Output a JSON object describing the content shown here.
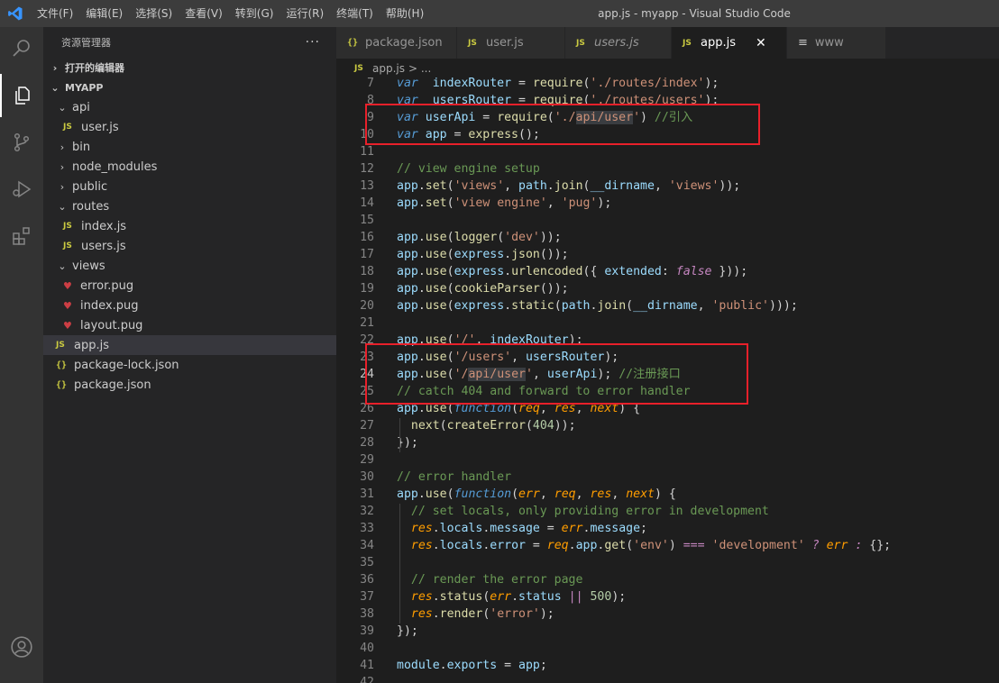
{
  "menu": [
    "文件(F)",
    "编辑(E)",
    "选择(S)",
    "查看(V)",
    "转到(G)",
    "运行(R)",
    "终端(T)",
    "帮助(H)"
  ],
  "window_title": "app.js - myapp - Visual Studio Code",
  "sidebar": {
    "title": "资源管理器",
    "more": "···",
    "open_editors": "打开的编辑器",
    "project": "MYAPP",
    "tree": [
      {
        "label": "api",
        "type": "folder-open",
        "indent": 1
      },
      {
        "label": "user.js",
        "type": "js",
        "indent": 2
      },
      {
        "label": "bin",
        "type": "folder",
        "indent": 1
      },
      {
        "label": "node_modules",
        "type": "folder",
        "indent": 1
      },
      {
        "label": "public",
        "type": "folder",
        "indent": 1
      },
      {
        "label": "routes",
        "type": "folder-open",
        "indent": 1
      },
      {
        "label": "index.js",
        "type": "js",
        "indent": 2
      },
      {
        "label": "users.js",
        "type": "js",
        "indent": 2
      },
      {
        "label": "views",
        "type": "folder-open",
        "indent": 1
      },
      {
        "label": "error.pug",
        "type": "pug",
        "indent": 2
      },
      {
        "label": "index.pug",
        "type": "pug",
        "indent": 2
      },
      {
        "label": "layout.pug",
        "type": "pug",
        "indent": 2
      },
      {
        "label": "app.js",
        "type": "js",
        "indent": 1,
        "selected": true
      },
      {
        "label": "package-lock.json",
        "type": "json",
        "indent": 1
      },
      {
        "label": "package.json",
        "type": "json",
        "indent": 1
      }
    ]
  },
  "tabs": [
    {
      "label": "package.json",
      "icon": "{}",
      "italic": false,
      "active": false
    },
    {
      "label": "user.js",
      "icon": "JS",
      "italic": false,
      "active": false
    },
    {
      "label": "users.js",
      "icon": "JS",
      "italic": true,
      "active": false
    },
    {
      "label": "app.js",
      "icon": "JS",
      "italic": false,
      "active": true,
      "close": "✕"
    },
    {
      "label": "www",
      "icon": "≡",
      "italic": false,
      "active": false
    }
  ],
  "breadcrumb": {
    "file": "app.js",
    "rest": "> ..."
  },
  "code": [
    {
      "n": 7,
      "tokens": [
        [
          "kw",
          "var"
        ],
        [
          "",
          "  "
        ],
        [
          "var",
          "indexRouter"
        ],
        [
          "op",
          " = "
        ],
        [
          "fn",
          "require"
        ],
        [
          "op",
          "("
        ],
        [
          "str",
          "'./routes/index'"
        ],
        [
          "op",
          ");"
        ]
      ]
    },
    {
      "n": 8,
      "tokens": [
        [
          "kw",
          "var"
        ],
        [
          "",
          "  "
        ],
        [
          "var",
          "usersRouter"
        ],
        [
          "op",
          " = "
        ],
        [
          "fn",
          "require"
        ],
        [
          "op",
          "("
        ],
        [
          "str",
          "'./routes/users'"
        ],
        [
          "op",
          ");"
        ]
      ]
    },
    {
      "n": 9,
      "tokens": [
        [
          "kw",
          "var"
        ],
        [
          "",
          ""
        ],
        [
          "var",
          " userApi"
        ],
        [
          "op",
          " = "
        ],
        [
          "fn",
          "require"
        ],
        [
          "op",
          "("
        ],
        [
          "str",
          "'./"
        ],
        [
          "str hl",
          "api/user"
        ],
        [
          "str",
          "'"
        ],
        [
          "op",
          ") "
        ],
        [
          "cm",
          "//引入"
        ]
      ]
    },
    {
      "n": 10,
      "tokens": [
        [
          "kw",
          "var"
        ],
        [
          "var",
          " app"
        ],
        [
          "op",
          " = "
        ],
        [
          "fn",
          "express"
        ],
        [
          "op",
          "();"
        ]
      ]
    },
    {
      "n": 11,
      "tokens": []
    },
    {
      "n": 12,
      "tokens": [
        [
          "cm",
          "// view engine setup"
        ]
      ]
    },
    {
      "n": 13,
      "tokens": [
        [
          "var",
          "app"
        ],
        [
          "op",
          "."
        ],
        [
          "fn",
          "set"
        ],
        [
          "op",
          "("
        ],
        [
          "str",
          "'views'"
        ],
        [
          "op",
          ", "
        ],
        [
          "var",
          "path"
        ],
        [
          "op",
          "."
        ],
        [
          "fn",
          "join"
        ],
        [
          "op",
          "("
        ],
        [
          "var",
          "__dirname"
        ],
        [
          "op",
          ", "
        ],
        [
          "str",
          "'views'"
        ],
        [
          "op",
          "));"
        ]
      ]
    },
    {
      "n": 14,
      "tokens": [
        [
          "var",
          "app"
        ],
        [
          "op",
          "."
        ],
        [
          "fn",
          "set"
        ],
        [
          "op",
          "("
        ],
        [
          "str",
          "'view engine'"
        ],
        [
          "op",
          ", "
        ],
        [
          "str",
          "'pug'"
        ],
        [
          "op",
          ");"
        ]
      ]
    },
    {
      "n": 15,
      "tokens": []
    },
    {
      "n": 16,
      "tokens": [
        [
          "var",
          "app"
        ],
        [
          "op",
          "."
        ],
        [
          "fn",
          "use"
        ],
        [
          "op",
          "("
        ],
        [
          "fn",
          "logger"
        ],
        [
          "op",
          "("
        ],
        [
          "str",
          "'dev'"
        ],
        [
          "op",
          "));"
        ]
      ]
    },
    {
      "n": 17,
      "tokens": [
        [
          "var",
          "app"
        ],
        [
          "op",
          "."
        ],
        [
          "fn",
          "use"
        ],
        [
          "op",
          "("
        ],
        [
          "var",
          "express"
        ],
        [
          "op",
          "."
        ],
        [
          "fn",
          "json"
        ],
        [
          "op",
          "());"
        ]
      ]
    },
    {
      "n": 18,
      "tokens": [
        [
          "var",
          "app"
        ],
        [
          "op",
          "."
        ],
        [
          "fn",
          "use"
        ],
        [
          "op",
          "("
        ],
        [
          "var",
          "express"
        ],
        [
          "op",
          "."
        ],
        [
          "fn",
          "urlencoded"
        ],
        [
          "op",
          "({ "
        ],
        [
          "var",
          "extended"
        ],
        [
          "op",
          ": "
        ],
        [
          "kw2",
          "false"
        ],
        [
          "op",
          " }));"
        ]
      ]
    },
    {
      "n": 19,
      "tokens": [
        [
          "var",
          "app"
        ],
        [
          "op",
          "."
        ],
        [
          "fn",
          "use"
        ],
        [
          "op",
          "("
        ],
        [
          "fn",
          "cookieParser"
        ],
        [
          "op",
          "());"
        ]
      ]
    },
    {
      "n": 20,
      "tokens": [
        [
          "var",
          "app"
        ],
        [
          "op",
          "."
        ],
        [
          "fn",
          "use"
        ],
        [
          "op",
          "("
        ],
        [
          "var",
          "express"
        ],
        [
          "op",
          "."
        ],
        [
          "fn",
          "static"
        ],
        [
          "op",
          "("
        ],
        [
          "var",
          "path"
        ],
        [
          "op",
          "."
        ],
        [
          "fn",
          "join"
        ],
        [
          "op",
          "("
        ],
        [
          "var",
          "__dirname"
        ],
        [
          "op",
          ", "
        ],
        [
          "str",
          "'public'"
        ],
        [
          "op",
          ")));"
        ]
      ]
    },
    {
      "n": 21,
      "tokens": []
    },
    {
      "n": 22,
      "tokens": [
        [
          "var",
          "app"
        ],
        [
          "op",
          "."
        ],
        [
          "fn",
          "use"
        ],
        [
          "op",
          "("
        ],
        [
          "str",
          "'/'"
        ],
        [
          "op",
          ", "
        ],
        [
          "var",
          "indexRouter"
        ],
        [
          "op",
          ");"
        ]
      ]
    },
    {
      "n": 23,
      "tokens": [
        [
          "var",
          "app"
        ],
        [
          "op",
          "."
        ],
        [
          "fn",
          "use"
        ],
        [
          "op",
          "("
        ],
        [
          "str",
          "'/users'"
        ],
        [
          "op",
          ", "
        ],
        [
          "var",
          "usersRouter"
        ],
        [
          "op",
          ");"
        ]
      ]
    },
    {
      "n": 24,
      "tokens": [
        [
          "var",
          "app"
        ],
        [
          "op",
          "."
        ],
        [
          "fn",
          "use"
        ],
        [
          "op",
          "("
        ],
        [
          "str",
          "'/"
        ],
        [
          "str hl",
          "api/user"
        ],
        [
          "str",
          "'"
        ],
        [
          "op",
          ", "
        ],
        [
          "var",
          "userApi"
        ],
        [
          "op",
          "); "
        ],
        [
          "cm",
          "//注册接口"
        ]
      ]
    },
    {
      "n": 25,
      "tokens": [
        [
          "cm",
          "// catch 404 and forward to error handler"
        ]
      ]
    },
    {
      "n": 26,
      "tokens": [
        [
          "var",
          "app"
        ],
        [
          "op",
          "."
        ],
        [
          "fn",
          "use"
        ],
        [
          "op",
          "("
        ],
        [
          "kw",
          "function"
        ],
        [
          "op",
          "("
        ],
        [
          "param",
          "req"
        ],
        [
          "op",
          ", "
        ],
        [
          "param",
          "res"
        ],
        [
          "op",
          ", "
        ],
        [
          "param",
          "next"
        ],
        [
          "op",
          ") {"
        ]
      ]
    },
    {
      "n": 27,
      "tokens": [
        [
          "op",
          "  "
        ],
        [
          "fn",
          "next"
        ],
        [
          "op",
          "("
        ],
        [
          "fn",
          "createError"
        ],
        [
          "op",
          "("
        ],
        [
          "num",
          "404"
        ],
        [
          "op",
          "));"
        ]
      ]
    },
    {
      "n": 28,
      "tokens": [
        [
          "op",
          "});"
        ]
      ]
    },
    {
      "n": 29,
      "tokens": []
    },
    {
      "n": 30,
      "tokens": [
        [
          "cm",
          "// error handler"
        ]
      ]
    },
    {
      "n": 31,
      "tokens": [
        [
          "var",
          "app"
        ],
        [
          "op",
          "."
        ],
        [
          "fn",
          "use"
        ],
        [
          "op",
          "("
        ],
        [
          "kw",
          "function"
        ],
        [
          "op",
          "("
        ],
        [
          "param",
          "err"
        ],
        [
          "op",
          ", "
        ],
        [
          "param",
          "req"
        ],
        [
          "op",
          ", "
        ],
        [
          "param",
          "res"
        ],
        [
          "op",
          ", "
        ],
        [
          "param",
          "next"
        ],
        [
          "op",
          ") {"
        ]
      ]
    },
    {
      "n": 32,
      "tokens": [
        [
          "op",
          "  "
        ],
        [
          "cm",
          "// set locals, only providing error in development"
        ]
      ]
    },
    {
      "n": 33,
      "tokens": [
        [
          "op",
          "  "
        ],
        [
          "param",
          "res"
        ],
        [
          "op",
          "."
        ],
        [
          "var",
          "locals"
        ],
        [
          "op",
          "."
        ],
        [
          "var",
          "message"
        ],
        [
          "op",
          " = "
        ],
        [
          "param",
          "err"
        ],
        [
          "op",
          "."
        ],
        [
          "var",
          "message"
        ],
        [
          "op",
          ";"
        ]
      ]
    },
    {
      "n": 34,
      "tokens": [
        [
          "op",
          "  "
        ],
        [
          "param",
          "res"
        ],
        [
          "op",
          "."
        ],
        [
          "var",
          "locals"
        ],
        [
          "op",
          "."
        ],
        [
          "var",
          "error"
        ],
        [
          "op",
          " = "
        ],
        [
          "param",
          "req"
        ],
        [
          "op",
          "."
        ],
        [
          "var",
          "app"
        ],
        [
          "op",
          "."
        ],
        [
          "fn",
          "get"
        ],
        [
          "op",
          "("
        ],
        [
          "str",
          "'env'"
        ],
        [
          "op",
          ") "
        ],
        [
          "kw2",
          "==="
        ],
        [
          "op",
          " "
        ],
        [
          "str",
          "'development'"
        ],
        [
          "op",
          " "
        ],
        [
          "kw2",
          "?"
        ],
        [
          "op",
          " "
        ],
        [
          "param",
          "err"
        ],
        [
          "op",
          " "
        ],
        [
          "kw2",
          ":"
        ],
        [
          "op",
          " {};"
        ]
      ]
    },
    {
      "n": 35,
      "tokens": []
    },
    {
      "n": 36,
      "tokens": [
        [
          "op",
          "  "
        ],
        [
          "cm",
          "// render the error page"
        ]
      ]
    },
    {
      "n": 37,
      "tokens": [
        [
          "op",
          "  "
        ],
        [
          "param",
          "res"
        ],
        [
          "op",
          "."
        ],
        [
          "fn",
          "status"
        ],
        [
          "op",
          "("
        ],
        [
          "param",
          "err"
        ],
        [
          "op",
          "."
        ],
        [
          "var",
          "status"
        ],
        [
          "op",
          " "
        ],
        [
          "kw2",
          "||"
        ],
        [
          "op",
          " "
        ],
        [
          "num",
          "500"
        ],
        [
          "op",
          ");"
        ]
      ]
    },
    {
      "n": 38,
      "tokens": [
        [
          "op",
          "  "
        ],
        [
          "param",
          "res"
        ],
        [
          "op",
          "."
        ],
        [
          "fn",
          "render"
        ],
        [
          "op",
          "("
        ],
        [
          "str",
          "'error'"
        ],
        [
          "op",
          ");"
        ]
      ]
    },
    {
      "n": 39,
      "tokens": [
        [
          "op",
          "});"
        ]
      ]
    },
    {
      "n": 40,
      "tokens": []
    },
    {
      "n": 41,
      "tokens": [
        [
          "var",
          "module"
        ],
        [
          "op",
          "."
        ],
        [
          "var",
          "exports"
        ],
        [
          "op",
          " = "
        ],
        [
          "var",
          "app"
        ],
        [
          "op",
          ";"
        ]
      ]
    },
    {
      "n": 42,
      "tokens": []
    }
  ],
  "active_line": 24,
  "colors": {
    "annotation": "#e8202a",
    "accent": "#007acc"
  }
}
